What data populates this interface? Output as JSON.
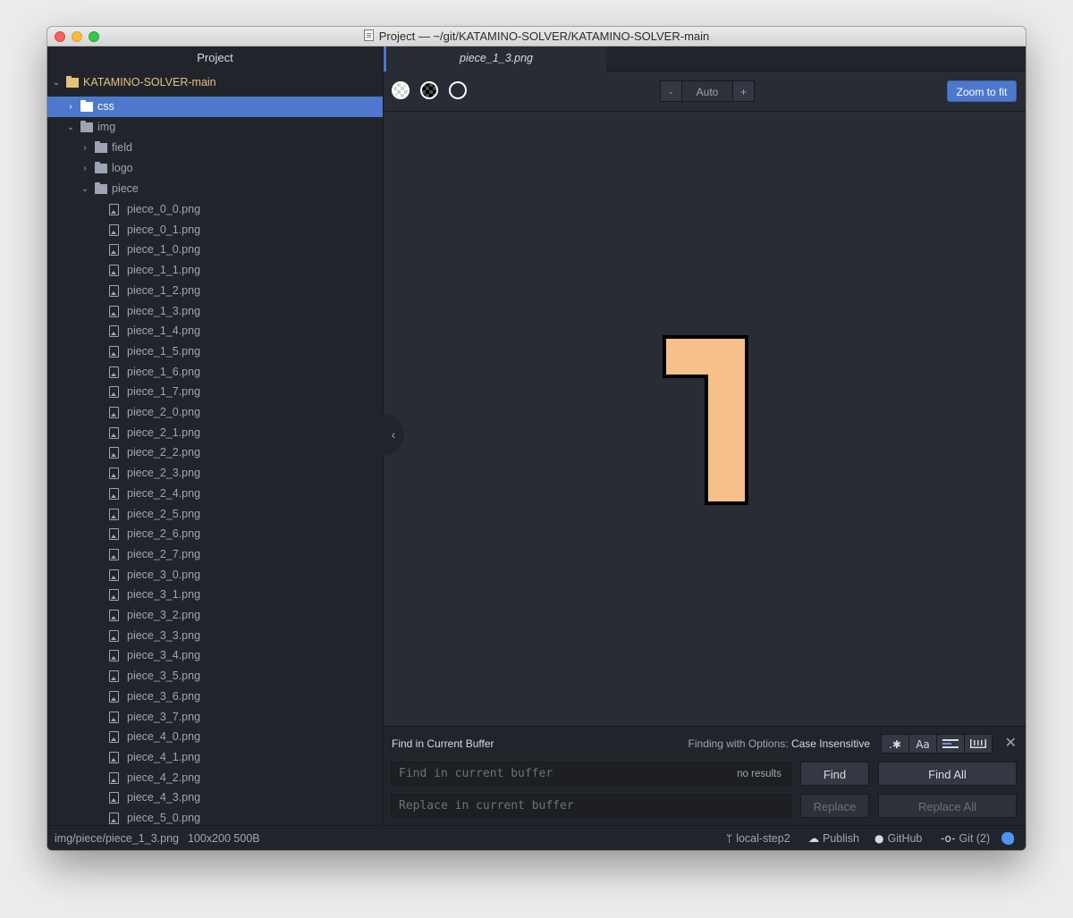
{
  "window": {
    "title": "Project — ~/git/KATAMINO-SOLVER/KATAMINO-SOLVER-main"
  },
  "tree": {
    "header": "Project",
    "root": "KATAMINO-SOLVER-main",
    "folders": {
      "css": "css",
      "img": "img",
      "field": "field",
      "logo": "logo",
      "piece": "piece"
    },
    "files": [
      "piece_0_0.png",
      "piece_0_1.png",
      "piece_1_0.png",
      "piece_1_1.png",
      "piece_1_2.png",
      "piece_1_3.png",
      "piece_1_4.png",
      "piece_1_5.png",
      "piece_1_6.png",
      "piece_1_7.png",
      "piece_2_0.png",
      "piece_2_1.png",
      "piece_2_2.png",
      "piece_2_3.png",
      "piece_2_4.png",
      "piece_2_5.png",
      "piece_2_6.png",
      "piece_2_7.png",
      "piece_3_0.png",
      "piece_3_1.png",
      "piece_3_2.png",
      "piece_3_3.png",
      "piece_3_4.png",
      "piece_3_5.png",
      "piece_3_6.png",
      "piece_3_7.png",
      "piece_4_0.png",
      "piece_4_1.png",
      "piece_4_2.png",
      "piece_4_3.png",
      "piece_5_0.png"
    ]
  },
  "editor": {
    "tab_label": "piece_1_3.png",
    "zoom": {
      "minus": "-",
      "level": "Auto",
      "plus": "+",
      "fit": "Zoom to fit"
    },
    "image": {
      "fill_color": "#f7c08a",
      "stroke_color": "#000000"
    }
  },
  "find": {
    "title": "Find in Current Buffer",
    "options_label": "Finding with Options:",
    "options_value": "Case Insensitive",
    "opt_regex": ".✱",
    "opt_case": "Aa",
    "find_placeholder": "Find in current buffer",
    "results": "no results",
    "replace_placeholder": "Replace in current buffer",
    "find_btn": "Find",
    "find_all_btn": "Find All",
    "replace_btn": "Replace",
    "replace_all_btn": "Replace All"
  },
  "status": {
    "path": "img/piece/piece_1_3.png",
    "info": "100x200 500B",
    "branch": "local-step2",
    "publish": "Publish",
    "github": "GitHub",
    "git": "Git (2)"
  }
}
